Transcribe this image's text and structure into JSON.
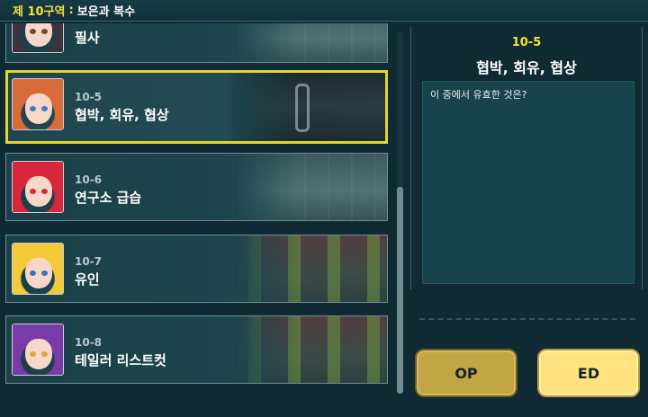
{
  "header": {
    "zone": "제 10구역",
    "separator": ":",
    "subtitle": "보은과 복수"
  },
  "stages": [
    {
      "number": "",
      "title": "필사",
      "hair_color": "#3a3340",
      "eye_color": "#6a4b3a"
    },
    {
      "number": "10-5",
      "title": "협박, 회유, 협상",
      "hair_color": "#d96a3a",
      "eye_color": "#3f7dbf",
      "selected": true
    },
    {
      "number": "10-6",
      "title": "연구소 급습",
      "hair_color": "#d8273a",
      "eye_color": "#d8273a"
    },
    {
      "number": "10-7",
      "title": "유인",
      "hair_color": "#f4c93a",
      "eye_color": "#3f6dbf"
    },
    {
      "number": "10-8",
      "title": "테일러 리스트컷",
      "hair_color": "#7a3aa8",
      "eye_color": "#e0a43a"
    }
  ],
  "detail": {
    "number": "10-5",
    "title": "협박, 회유, 협상",
    "prompt": "이 중에서 유효한 것은?"
  },
  "buttons": {
    "op": "OP",
    "ed": "ED"
  }
}
